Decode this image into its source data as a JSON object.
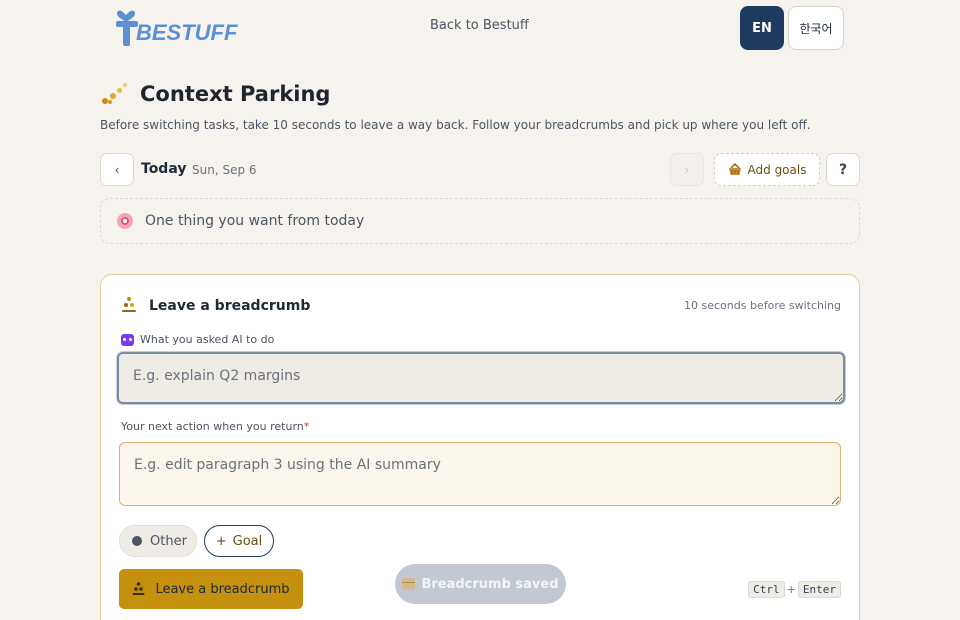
{
  "header": {
    "logo_text": "BESTUFF",
    "back_link": "Back to Bestuff",
    "lang_en": "EN",
    "lang_ko": "한국어"
  },
  "page": {
    "title": "Context Parking",
    "subtitle": "Before switching tasks, take 10 seconds to leave a way back. Follow your breadcrumbs and pick up where you left off."
  },
  "day_nav": {
    "prev": "‹",
    "next": "›",
    "today": "Today",
    "date": "Sun, Sep 6",
    "add_goals": "Add goals",
    "help": "?"
  },
  "goal_input": {
    "placeholder": "One thing you want from today"
  },
  "breadcrumb_card": {
    "title": "Leave a breadcrumb",
    "hint": "10 seconds before switching",
    "ai_label": "What you asked AI to do",
    "ai_placeholder": "E.g. explain Q2 margins",
    "next_label": "Your next action when you return",
    "next_required": "*",
    "next_placeholder": "E.g. edit paragraph 3 using the AI summary",
    "chip_other": "Other",
    "chip_goal_plus": "+",
    "chip_goal": "Goal",
    "submit": "Leave a breadcrumb",
    "shortcut_key1": "Ctrl",
    "shortcut_plus": "+",
    "shortcut_key2": "Enter"
  },
  "toast": {
    "text": "Breadcrumb saved"
  },
  "colors": {
    "accent": "#c4900d",
    "navy": "#1e3a5f",
    "background": "#f6f3ee"
  }
}
